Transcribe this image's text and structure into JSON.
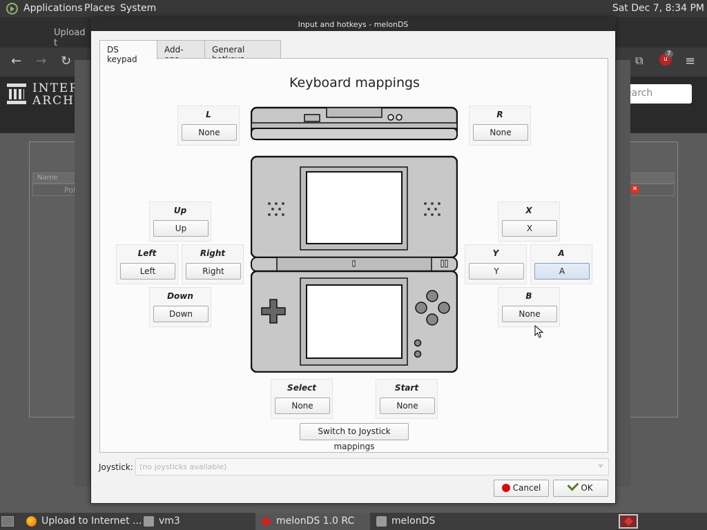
{
  "topbar": {
    "menus": [
      "Applications",
      "Places",
      "System"
    ],
    "clock": "Sat Dec 7,  8:34 PM"
  },
  "background": {
    "tab_title": "Upload t",
    "ia_line1": "INTERN",
    "ia_line2": "ARCHIV",
    "search_placeholder": "earch",
    "column_name": "Name",
    "row_text": "Pok",
    "badge_count": "7"
  },
  "dialog": {
    "title": "Input and hotkeys - melonDS",
    "tabs": [
      "DS keypad",
      "Add-ons",
      "General hotkeys"
    ],
    "heading": "Keyboard mappings",
    "keys": {
      "l": {
        "label": "L",
        "value": "None"
      },
      "r": {
        "label": "R",
        "value": "None"
      },
      "up": {
        "label": "Up",
        "value": "Up"
      },
      "left": {
        "label": "Left",
        "value": "Left"
      },
      "right": {
        "label": "Right",
        "value": "Right"
      },
      "down": {
        "label": "Down",
        "value": "Down"
      },
      "x": {
        "label": "X",
        "value": "X"
      },
      "y": {
        "label": "Y",
        "value": "Y"
      },
      "a": {
        "label": "A",
        "value": "A"
      },
      "b": {
        "label": "B",
        "value": "None"
      },
      "select": {
        "label": "Select",
        "value": "None"
      },
      "start": {
        "label": "Start",
        "value": "None"
      }
    },
    "switch_button": "Switch to Joystick mappings",
    "joystick_label": "Joystick:",
    "joystick_value": "(no joysticks available)",
    "cancel_button": "Cancel",
    "ok_button": "OK"
  },
  "taskbar": {
    "items": [
      "Upload to Internet ...",
      "vm3",
      "melonDS 1.0 RC",
      "melonDS"
    ]
  }
}
